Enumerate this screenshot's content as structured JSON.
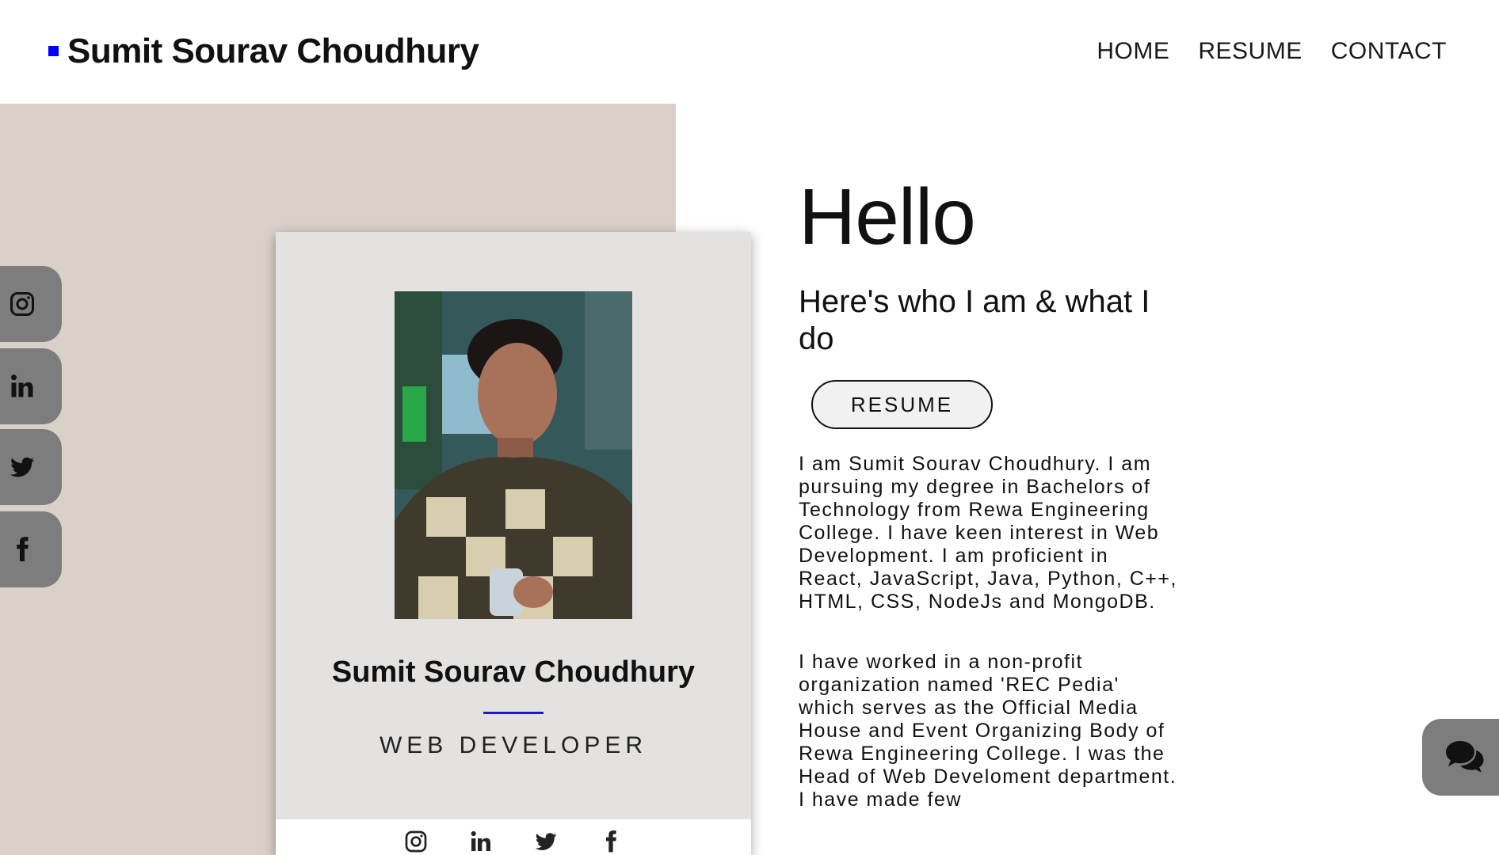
{
  "header": {
    "site_name": "Sumit Sourav Choudhury",
    "nav": [
      {
        "label": "HOME"
      },
      {
        "label": "RESUME"
      },
      {
        "label": "CONTACT"
      }
    ]
  },
  "social_links": [
    "instagram-icon",
    "linkedin-icon",
    "twitter-icon",
    "facebook-icon"
  ],
  "profile_card": {
    "name": "Sumit Sourav Choudhury",
    "role": "WEB DEVELOPER",
    "accent_color": "#1a1acc"
  },
  "intro": {
    "greeting": "Hello",
    "subtitle": "Here's who I am & what I do",
    "resume_button": "RESUME",
    "paragraphs": [
      "I am Sumit Sourav Choudhury. I am pursuing my degree in Bachelors of Technology from Rewa Engineering College. I have keen interest in Web Development. I am proficient in React, JavaScript, Java, Python, C++, HTML, CSS, NodeJs and MongoDB.",
      "I have worked in a non-profit organization named 'REC Pedia' which serves as the Official Media House and Event Organizing Body of Rewa Engineering College. I was the Head of Web Develoment department. I have made few"
    ]
  },
  "colors": {
    "brand_square": "#0000ff",
    "beige_panel": "#d9d1c7",
    "card_bg": "#e4e2e0",
    "tab_gray": "#7d7d7d"
  }
}
